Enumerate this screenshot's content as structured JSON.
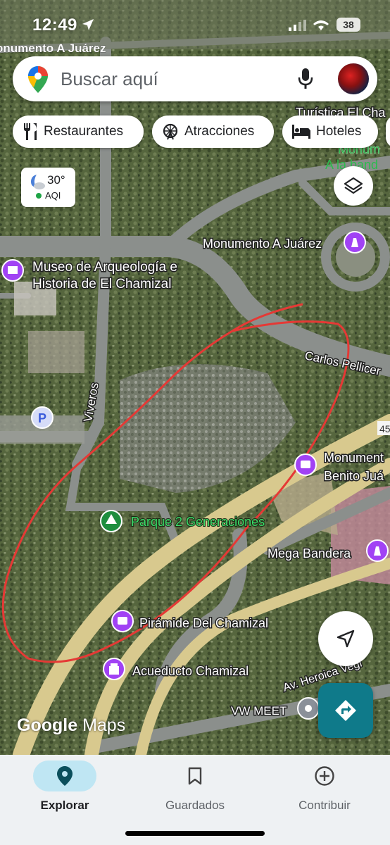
{
  "status_bar": {
    "time": "12:49",
    "battery": "38"
  },
  "search": {
    "placeholder": "Buscar aquí"
  },
  "chips": [
    {
      "label": "Restaurantes",
      "icon": "fork-knife-icon"
    },
    {
      "label": "Atracciones",
      "icon": "ferris-wheel-icon"
    },
    {
      "label": "Hoteles",
      "icon": "bed-icon"
    }
  ],
  "weather": {
    "temp": "30°",
    "aqi": "AQI",
    "aqi_color": "#1ea446"
  },
  "map_labels": {
    "street_top": "onumento A Juárez",
    "turistica": "Turística El Cha",
    "monum_top": "Monum",
    "a_la_band": "A la band",
    "monumento_juarez": "Monumento A Juárez",
    "museo_line1": "Museo de Arqueología e",
    "museo_line2": "Historia de El Chamizal",
    "carlos": "Carlos Pellicer",
    "viveros": "Viveros",
    "route_45": "45",
    "monum_benito_1": "Monument",
    "monum_benito_2": "Benito Juá",
    "parque": "Parque 2 Generaciones",
    "mega_bandera": "Mega Bandera",
    "piramide": "Pirámide Del Chamizal",
    "acueducto": "Acueducto Chamizal",
    "av_heroica": "Av. Heroica Vegi",
    "vw_meet": "VW MEET",
    "parking": "P"
  },
  "brand": {
    "google": "Google",
    "maps": "Maps"
  },
  "bottom_nav": [
    {
      "label": "Explorar",
      "icon": "location-pin-icon",
      "active": true
    },
    {
      "label": "Guardados",
      "icon": "bookmark-icon",
      "active": false
    },
    {
      "label": "Contribuir",
      "icon": "plus-circle-icon",
      "active": false
    }
  ],
  "colors": {
    "poi_purple": "#a142f4",
    "park_green": "#1e8e3e",
    "directions_teal": "#0f7a8a",
    "annotation_red": "#e53935",
    "road_yellow": "#e8d89a"
  }
}
